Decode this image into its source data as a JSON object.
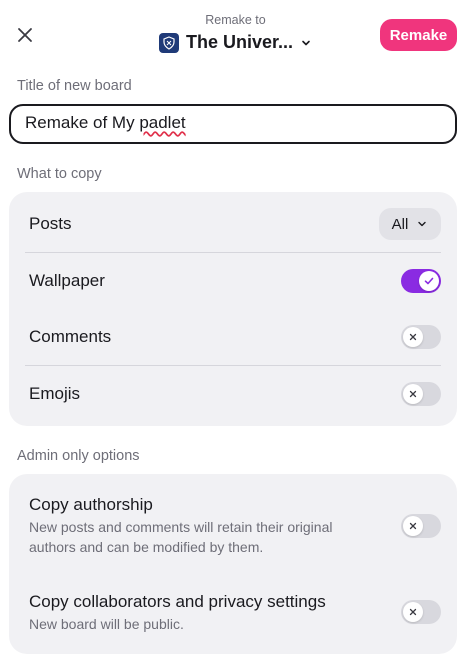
{
  "header": {
    "remake_to": "Remake to",
    "target_name": "The Univer...",
    "remake_button": "Remake"
  },
  "title_section": {
    "label": "Title of new board",
    "value_prefix": "Remake of My ",
    "value_misspelled": "padlet"
  },
  "copy_section": {
    "label": "What to copy",
    "items": [
      {
        "label": "Posts",
        "control": "dropdown",
        "value": "All"
      },
      {
        "label": "Wallpaper",
        "control": "toggle",
        "on": true
      },
      {
        "label": "Comments",
        "control": "toggle",
        "on": false
      },
      {
        "label": "Emojis",
        "control": "toggle",
        "on": false
      }
    ]
  },
  "admin_section": {
    "label": "Admin only options",
    "items": [
      {
        "title": "Copy authorship",
        "description": "New posts and comments will retain their original authors and can be modified by them.",
        "on": false
      },
      {
        "title": "Copy collaborators and privacy settings",
        "description": "New board will be public.",
        "on": false
      }
    ]
  },
  "colors": {
    "accent_pink": "#f0357d",
    "toggle_on": "#8a2be2",
    "card_bg": "#f1f1f4"
  }
}
